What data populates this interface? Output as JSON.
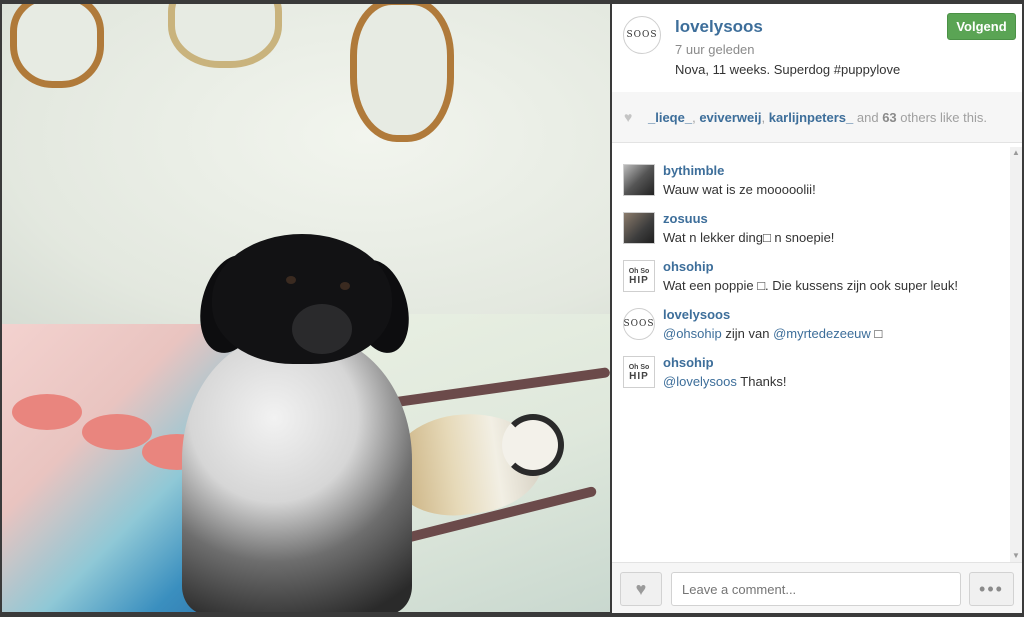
{
  "post": {
    "photo_alt": "puppy-photo"
  },
  "owner": {
    "username": "lovelysoos",
    "avatar_text": "SOOS",
    "time_ago": "7 uur geleden",
    "caption": "Nova, 11 weeks. Superdog #puppylove"
  },
  "follow_label": "Volgend",
  "likes": {
    "users": [
      "_lieqe_",
      "eviverweij",
      "karlijnpeters_"
    ],
    "sep": ", ",
    "and": " and ",
    "count": "63",
    "suffix": " others like this."
  },
  "comments": [
    {
      "user": "bythimble",
      "avatar": "photo",
      "text": "Wauw wat is ze mooooolii!"
    },
    {
      "user": "zosuus",
      "avatar": "photo2",
      "text": "Wat n lekker ding□ n snoepie!"
    },
    {
      "user": "ohsohip",
      "avatar": "ohsohip",
      "text": "Wat een poppie □. Die kussens zijn ook super leuk!"
    },
    {
      "user": "lovelysoos",
      "avatar": "soos",
      "text_parts": [
        "@ohsohip",
        " zijn van ",
        "@myrtedezeeuw",
        " □"
      ]
    },
    {
      "user": "ohsohip",
      "avatar": "ohsohip",
      "text_parts": [
        "@lovelysoos",
        " Thanks!"
      ]
    }
  ],
  "avatar_ohsohip": {
    "line1": "Oh So",
    "line2": "HIP"
  },
  "comment_input": {
    "placeholder": "Leave a comment..."
  },
  "more_label": "•••",
  "icons": {
    "heart": "heart-icon",
    "scroll_up": "scroll-up-arrow",
    "scroll_down": "scroll-down-arrow"
  },
  "colors": {
    "link": "#3d6e9a",
    "follow": "#5aa454"
  }
}
